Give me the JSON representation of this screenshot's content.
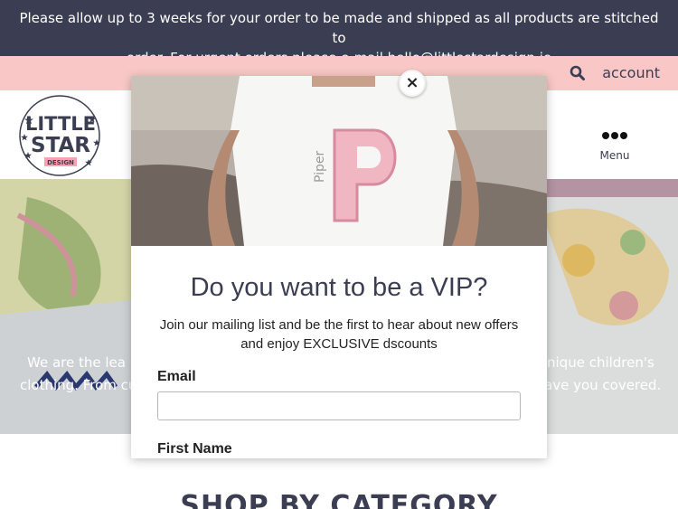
{
  "notice": {
    "line1": "Please allow up to 3 weeks for your order to be made and shipped as all products are stitched to",
    "line2": "order. For urgent orders please e-mail hello@littlestardesign.ie"
  },
  "util": {
    "search_icon": "search-icon",
    "account_label": "account"
  },
  "header": {
    "logo_lines": [
      "LITTLE",
      "STAR",
      "DESIGN"
    ],
    "menu_label": "Menu"
  },
  "hero": {
    "line1_left": "We are the lea",
    "line1_right": "nique children's",
    "line2_left": "clothing. From cu",
    "line2_right": "ave you covered."
  },
  "section": {
    "heading": "SHOP BY CATEGORY"
  },
  "modal": {
    "close_label": "×",
    "shirt_name": "Piper",
    "shirt_letter": "P",
    "title": "Do you want to be a VIP?",
    "subtitle_line1": "Join our mailing list and be the first to hear about new offers",
    "subtitle_line2": "and enjoy EXCLUSIVE dscounts",
    "email_label": "Email",
    "email_value": "",
    "first_name_label": "First Name"
  },
  "colors": {
    "navy": "#3b3d52",
    "pink_bar": "#f9c8c6",
    "white": "#ffffff"
  }
}
